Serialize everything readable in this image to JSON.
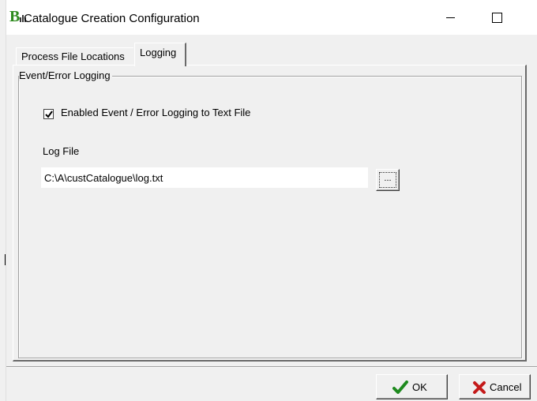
{
  "window": {
    "title": "Catalogue Creation Configuration",
    "icon": "b-bars-app-icon",
    "brand_color": "#2e8b1e"
  },
  "tabs": [
    {
      "label": "Process File Locations",
      "active": false
    },
    {
      "label": "Logging",
      "active": true
    }
  ],
  "logging": {
    "group_title": "Event/Error Logging",
    "enable_checkbox": {
      "label": "Enabled Event / Error Logging to Text File",
      "checked": true
    },
    "log_file_label": "Log File",
    "log_file_value": "C:\\A\\custCatalogue\\log.txt",
    "browse_label": "..."
  },
  "buttons": {
    "ok": {
      "label": "OK",
      "icon": "checkmark-icon",
      "color": "#1f8a1f"
    },
    "cancel": {
      "label": "Cancel",
      "icon": "x-cross-icon",
      "color": "#c41a1a"
    }
  }
}
